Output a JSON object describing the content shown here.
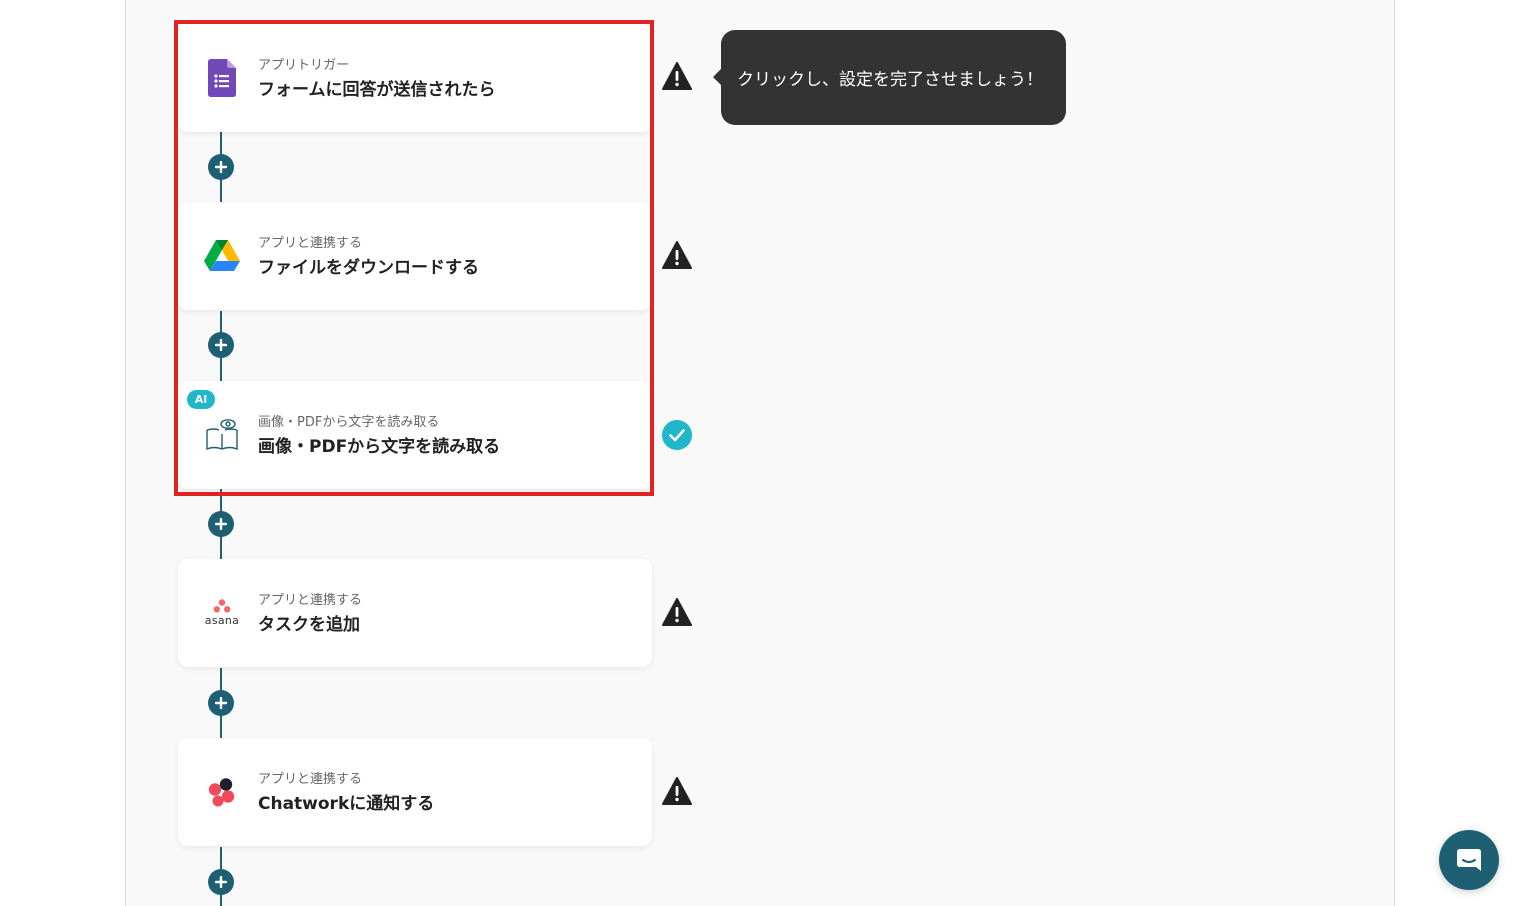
{
  "tooltip": {
    "text": "クリックし、設定を完了させましょう！"
  },
  "steps": [
    {
      "sub": "アプリトリガー",
      "title": "フォームに回答が送信されたら",
      "icon": "google-forms-icon",
      "status": "warning"
    },
    {
      "sub": "アプリと連携する",
      "title": "ファイルをダウンロードする",
      "icon": "google-drive-icon",
      "status": "warning"
    },
    {
      "sub": "画像・PDFから文字を読み取る",
      "title": "画像・PDFから文字を読み取る",
      "icon": "ocr-book-icon",
      "status": "done",
      "badge": "AI"
    },
    {
      "sub": "アプリと連携する",
      "title": "タスクを追加",
      "icon": "asana-logo-icon",
      "status": "warning",
      "logo_text": "asana"
    },
    {
      "sub": "アプリと連携する",
      "title": "Chatworkに通知する",
      "icon": "chatwork-logo-icon",
      "status": "warning"
    }
  ],
  "colors": {
    "flow": "#1f5f74",
    "highlight": "#e02424",
    "done": "#1fb7c9",
    "warning": "#222222",
    "tooltip_bg": "#333333"
  }
}
